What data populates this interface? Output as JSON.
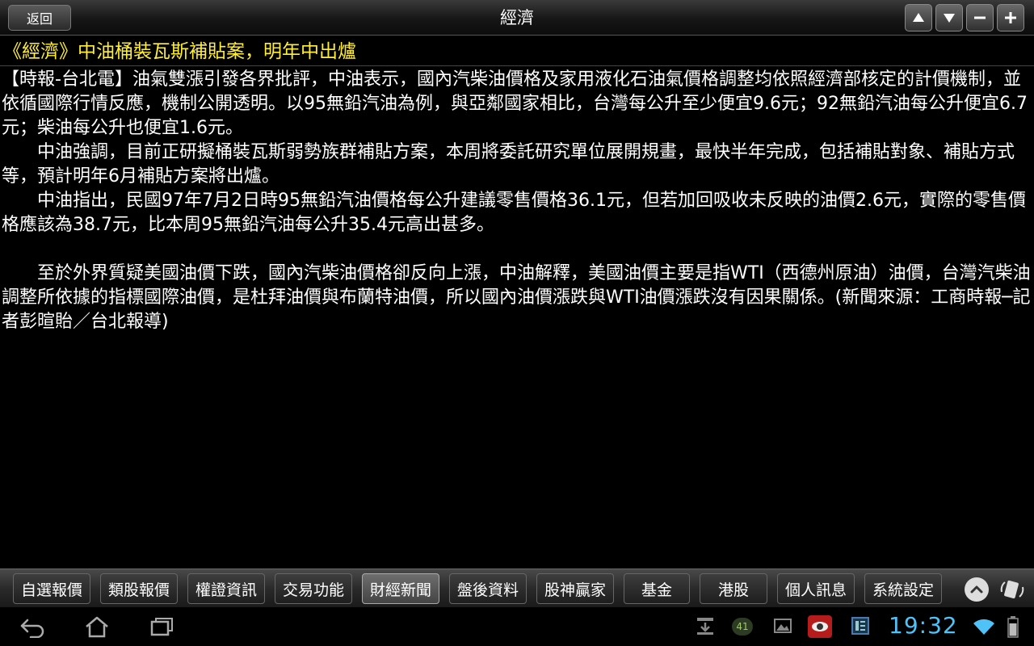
{
  "header": {
    "back_label": "返回",
    "title": "經濟"
  },
  "headline": "《經濟》中油桶裝瓦斯補貼案，明年中出爐",
  "article": {
    "paragraphs": [
      "【時報-台北電】油氣雙漲引發各界批評，中油表示，國內汽柴油價格及家用液化石油氣價格調整均依照經濟部核定的計價機制，並依循國際行情反應，機制公開透明。以95無鉛汽油為例，與亞鄰國家相比，台灣每公升至少便宜9.6元；92無鉛汽油每公升便宜6.7元；柴油每公升也便宜1.6元。",
      "中油強調，目前正研擬桶裝瓦斯弱勢族群補貼方案，本周將委託研究單位展開規畫，最快半年完成，包括補貼對象、補貼方式等，預計明年6月補貼方案將出爐。",
      "中油指出，民國97年7月2日時95無鉛汽油價格每公升建議零售價格36.1元，但若加回吸收未反映的油價2.6元，實際的零售價格應該為38.7元，比本周95無鉛汽油每公升35.4元高出甚多。",
      "至於外界質疑美國油價下跌，國內汽柴油價格卻反向上漲，中油解釋，美國油價主要是指WTI（西德州原油）油價，台灣汽柴油調整所依據的指標國際油價，是杜拜油價與布蘭特油價，所以國內油價漲跌與WTI油價漲跌沒有因果關係。(新聞來源：工商時報─記者彭暄貽／台北報導)"
    ]
  },
  "tabs": [
    {
      "label": "自選報價",
      "active": false
    },
    {
      "label": "類股報價",
      "active": false
    },
    {
      "label": "權證資訊",
      "active": false
    },
    {
      "label": "交易功能",
      "active": false
    },
    {
      "label": "財經新聞",
      "active": true
    },
    {
      "label": "盤後資料",
      "active": false
    },
    {
      "label": "股神贏家",
      "active": false
    },
    {
      "label": "基金",
      "active": false
    },
    {
      "label": "港股",
      "active": false
    },
    {
      "label": "個人訊息",
      "active": false
    },
    {
      "label": "系統設定",
      "active": false
    }
  ],
  "status": {
    "clock": "19:32",
    "notification_badge": "41"
  },
  "colors": {
    "headline": "#ffee33",
    "clock": "#4fc3f7"
  }
}
